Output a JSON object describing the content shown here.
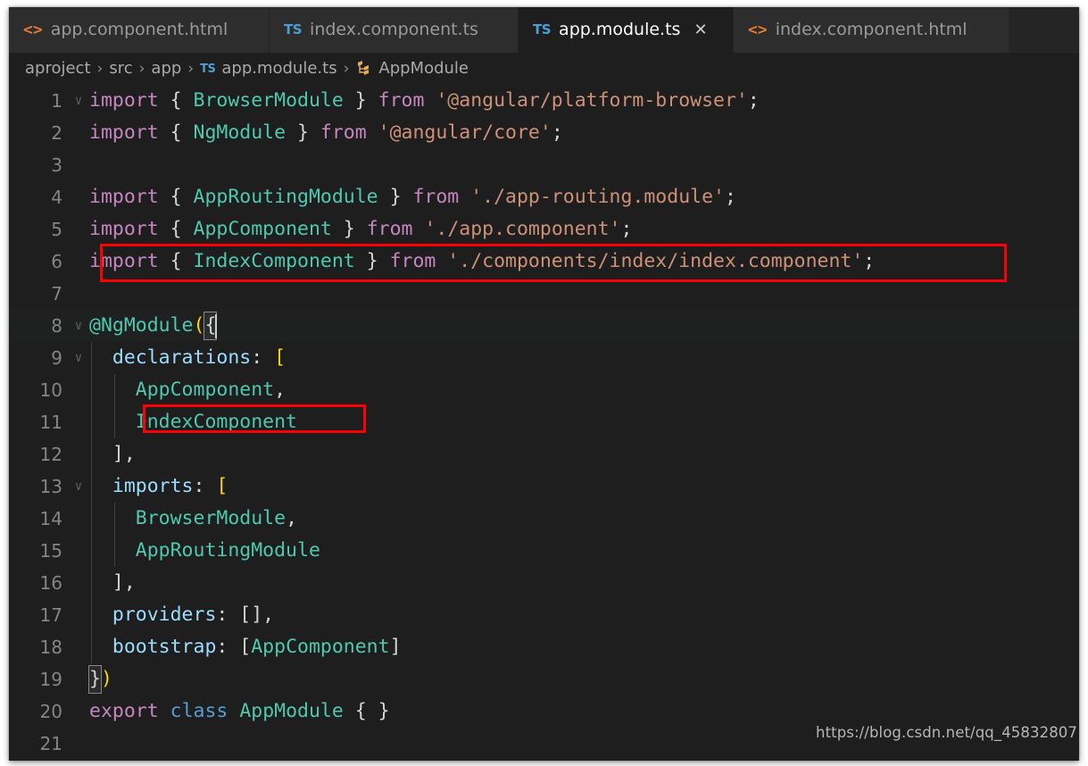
{
  "window": {
    "app": "Visual Studio Code",
    "background": "#1e1e1e",
    "accent_red": "#fb0007"
  },
  "tabbar": {
    "tabs": [
      {
        "label": "app.component.html",
        "icon": "html-file-icon",
        "icon_glyph": "<>",
        "active": false,
        "closable": false,
        "close_glyph": ""
      },
      {
        "label": "index.component.ts",
        "icon": "typescript-file-icon",
        "icon_glyph": "TS",
        "active": false,
        "closable": false,
        "close_glyph": ""
      },
      {
        "label": "app.module.ts",
        "icon": "typescript-file-icon",
        "icon_glyph": "TS",
        "active": true,
        "closable": true,
        "close_glyph": "✕"
      },
      {
        "label": "index.component.html",
        "icon": "html-file-icon",
        "icon_glyph": "<>",
        "active": false,
        "closable": false,
        "close_glyph": ""
      }
    ]
  },
  "breadcrumb": {
    "separator": "›",
    "items": [
      {
        "label": "aproject",
        "icon": ""
      },
      {
        "label": "src",
        "icon": ""
      },
      {
        "label": "app",
        "icon": ""
      },
      {
        "label": "app.module.ts",
        "icon": "typescript-file-icon",
        "icon_glyph": "TS"
      },
      {
        "label": "AppModule",
        "icon": "class-symbol-icon",
        "icon_glyph": "⚇"
      }
    ]
  },
  "editor": {
    "language": "TypeScript",
    "file": "app.module.ts",
    "fold_glyph": "∨",
    "lines": [
      {
        "n": "1",
        "fold": true
      },
      {
        "n": "2",
        "fold": false
      },
      {
        "n": "3",
        "fold": false
      },
      {
        "n": "4",
        "fold": false
      },
      {
        "n": "5",
        "fold": false
      },
      {
        "n": "6",
        "fold": false
      },
      {
        "n": "7",
        "fold": false
      },
      {
        "n": "8",
        "fold": true
      },
      {
        "n": "9",
        "fold": true
      },
      {
        "n": "10",
        "fold": false
      },
      {
        "n": "11",
        "fold": false
      },
      {
        "n": "12",
        "fold": false
      },
      {
        "n": "13",
        "fold": true
      },
      {
        "n": "14",
        "fold": false
      },
      {
        "n": "15",
        "fold": false
      },
      {
        "n": "16",
        "fold": false
      },
      {
        "n": "17",
        "fold": false
      },
      {
        "n": "18",
        "fold": false
      },
      {
        "n": "19",
        "fold": false
      },
      {
        "n": "20",
        "fold": false
      },
      {
        "n": "21",
        "fold": false
      }
    ],
    "source": {
      "l1_import": "import",
      "l1_open": " { ",
      "l1_type": "BrowserModule",
      "l1_close": " } ",
      "l1_from": "from",
      "l1_str": " '@angular/platform-browser'",
      "l1_semi": ";",
      "l2_import": "import",
      "l2_open": " { ",
      "l2_type": "NgModule",
      "l2_close": " } ",
      "l2_from": "from",
      "l2_str": " '@angular/core'",
      "l2_semi": ";",
      "l4_import": "import",
      "l4_open": " { ",
      "l4_type": "AppRoutingModule",
      "l4_close": " } ",
      "l4_from": "from",
      "l4_str": " './app-routing.module'",
      "l4_semi": ";",
      "l5_import": "import",
      "l5_open": " { ",
      "l5_type": "AppComponent",
      "l5_close": " } ",
      "l5_from": "from",
      "l5_str": " './app.component'",
      "l5_semi": ";",
      "l6_import": "import",
      "l6_open": " { ",
      "l6_type": "IndexComponent",
      "l6_close": " } ",
      "l6_from": "from",
      "l6_str": " './components/index/index.component'",
      "l6_semi": ";",
      "l8_deco": "@NgModule",
      "l8_paren": "(",
      "l8_brace": "{",
      "l9_prop": "declarations",
      "l9_colon": ": ",
      "l9_bracket": "[",
      "l10_type": "AppComponent",
      "l10_comma": ",",
      "l11_type": "IndexComponent",
      "l12_text": "],",
      "l13_prop": "imports",
      "l13_colon": ": ",
      "l13_bracket": "[",
      "l14_type": "BrowserModule",
      "l14_comma": ",",
      "l15_type": "AppRoutingModule",
      "l16_text": "],",
      "l17_prop": "providers",
      "l17_colon": ": ",
      "l17_val": "[],",
      "l18_prop": "bootstrap",
      "l18_colon": ": ",
      "l18_open": "[",
      "l18_type": "AppComponent",
      "l18_close": "]",
      "l19_brace": "}",
      "l19_paren": ")",
      "l20_export": "export",
      "l20_sp1": " ",
      "l20_class": "class",
      "l20_sp2": " ",
      "l20_name": "AppModule",
      "l20_body": " { }"
    }
  },
  "annotations": [
    {
      "name": "highlight-import-indexcomponent",
      "color": "#fb0007"
    },
    {
      "name": "highlight-declaration-indexcomponent",
      "color": "#fb0007"
    }
  ],
  "watermark": {
    "text": "https://blog.csdn.net/qq_45832807"
  }
}
